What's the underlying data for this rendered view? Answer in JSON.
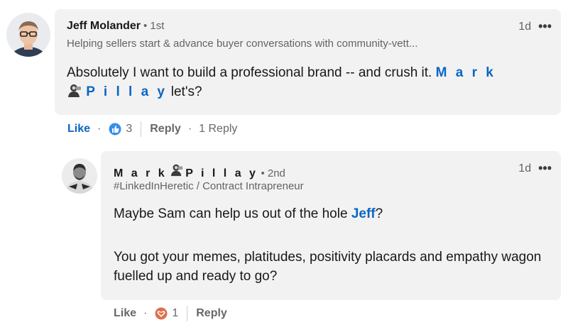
{
  "comments": [
    {
      "author": "Jeff Molander",
      "degree": "• 1st",
      "headline": "Helping sellers start & advance buyer conversations with community-vett...",
      "time": "1d",
      "more": "•••",
      "body": {
        "text_before": "Absolutely I want to build a professional brand -- and crush it. ",
        "mention_first": "M a r k",
        "mention_last": "P i l l a y",
        "text_after": " let's?"
      },
      "actions": {
        "like_label": "Like",
        "reaction_count": "3",
        "reply_label": "Reply",
        "replies_link": "1 Reply"
      }
    },
    {
      "author_first": "M a r k",
      "author_last": "P i l l a y",
      "degree": "• 2nd",
      "headline": "#LinkedInHeretic / Contract Intrapreneur",
      "time": "1d",
      "more": "•••",
      "body": {
        "line1_before": "Maybe Sam can help us out of the hole ",
        "line1_mention": "Jeff",
        "line1_after": "?",
        "paragraph2": "You got your memes, platitudes, positivity placards and empathy wagon fuelled up and ready to go?"
      },
      "actions": {
        "like_label": "Like",
        "reaction_count": "1",
        "reply_label": "Reply"
      }
    }
  ],
  "colors": {
    "accent": "#0a66c2",
    "bubble_bg": "#f2f2f2",
    "like_icon": "#378fe9",
    "love_icon": "#df704d"
  },
  "icons": {
    "like_reaction": "thumbs-up-icon",
    "love_reaction": "heart-icon",
    "name_emoji": "person-emoji-icon"
  }
}
